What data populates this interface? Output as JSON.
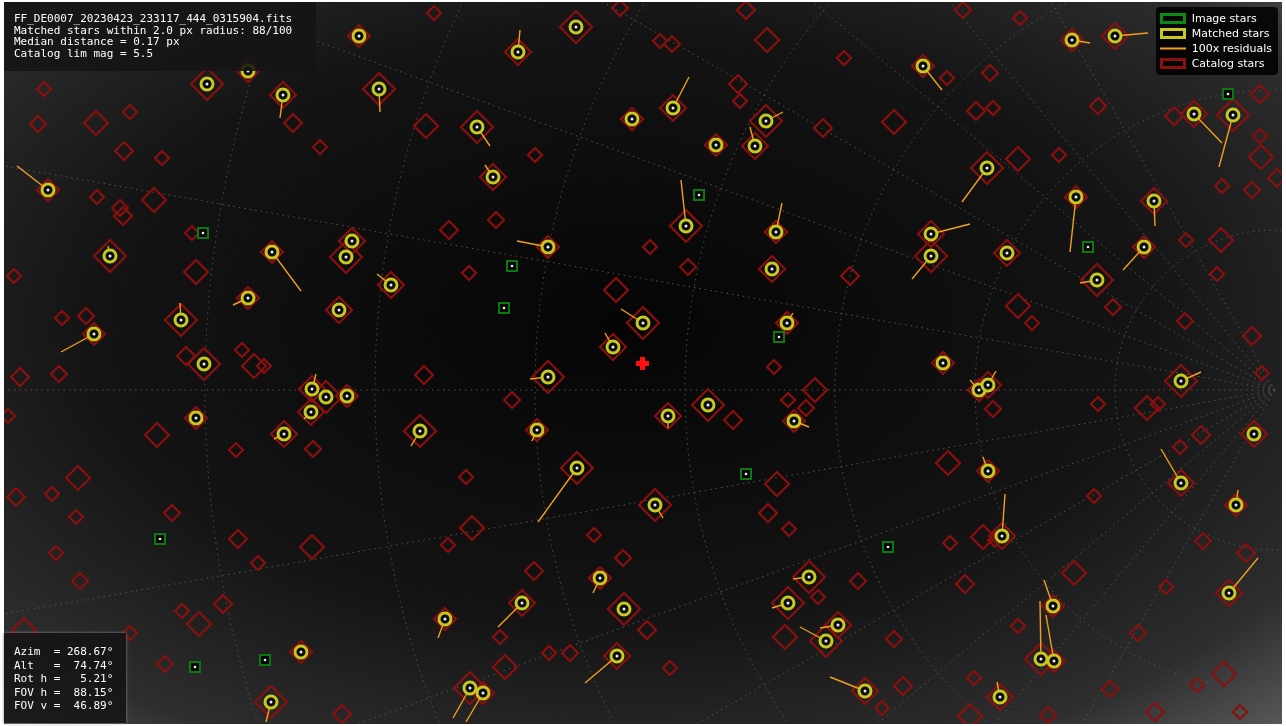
{
  "image_info": {
    "lines": [
      "FF_DE0007_20230423_233117_444_0315904.fits",
      "Matched stars within 2.0 px radius: 88/100",
      "Median distance = 0.17 px",
      "Catalog lim mag = 5.5"
    ]
  },
  "legend": {
    "items": [
      {
        "label": "Image stars",
        "kind": "image"
      },
      {
        "label": "Matched stars",
        "kind": "matched"
      },
      {
        "label": "100x residuals",
        "kind": "residual"
      },
      {
        "label": "Catalog stars",
        "kind": "catalog"
      }
    ]
  },
  "pointing_info": {
    "lines": [
      "Azim  = 268.67°",
      "Alt   =  74.74°",
      "Rot h =   5.21°",
      "FOV h =  88.15°",
      "FOV v =  46.89°"
    ]
  }
}
